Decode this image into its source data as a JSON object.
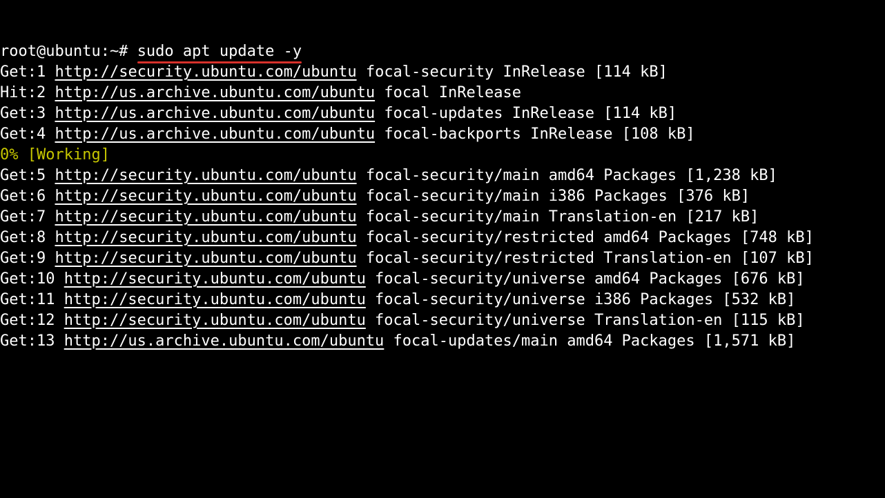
{
  "prompt": "root@ubuntu:~# ",
  "command": "sudo apt update -y",
  "status_line": "0% [Working]",
  "lines": [
    {
      "type": "get",
      "prefix": "Get:1 ",
      "url": "http://security.ubuntu.com/ubuntu",
      "suffix": " focal-security InRelease [114 kB]"
    },
    {
      "type": "hit",
      "prefix": "Hit:2 ",
      "url": "http://us.archive.ubuntu.com/ubuntu",
      "suffix": " focal InRelease"
    },
    {
      "type": "get",
      "prefix": "Get:3 ",
      "url": "http://us.archive.ubuntu.com/ubuntu",
      "suffix": " focal-updates InRelease [114 kB]"
    },
    {
      "type": "get",
      "prefix": "Get:4 ",
      "url": "http://us.archive.ubuntu.com/ubuntu",
      "suffix": " focal-backports InRelease [108 kB]"
    },
    {
      "type": "status"
    },
    {
      "type": "get",
      "prefix": "Get:5 ",
      "url": "http://security.ubuntu.com/ubuntu",
      "suffix": " focal-security/main amd64 Packages [1,238 kB]"
    },
    {
      "type": "get",
      "prefix": "Get:6 ",
      "url": "http://security.ubuntu.com/ubuntu",
      "suffix": " focal-security/main i386 Packages [376 kB]"
    },
    {
      "type": "get",
      "prefix": "Get:7 ",
      "url": "http://security.ubuntu.com/ubuntu",
      "suffix": " focal-security/main Translation-en [217 kB]"
    },
    {
      "type": "get",
      "prefix": "Get:8 ",
      "url": "http://security.ubuntu.com/ubuntu",
      "suffix": " focal-security/restricted amd64 Packages [748 kB]"
    },
    {
      "type": "get",
      "prefix": "Get:9 ",
      "url": "http://security.ubuntu.com/ubuntu",
      "suffix": " focal-security/restricted Translation-en [107 kB]"
    },
    {
      "type": "get",
      "prefix": "Get:10 ",
      "url": "http://security.ubuntu.com/ubuntu",
      "suffix": " focal-security/universe amd64 Packages [676 kB]"
    },
    {
      "type": "get",
      "prefix": "Get:11 ",
      "url": "http://security.ubuntu.com/ubuntu",
      "suffix": " focal-security/universe i386 Packages [532 kB]"
    },
    {
      "type": "get",
      "prefix": "Get:12 ",
      "url": "http://security.ubuntu.com/ubuntu",
      "suffix": " focal-security/universe Translation-en [115 kB]"
    },
    {
      "type": "get",
      "prefix": "Get:13 ",
      "url": "http://us.archive.ubuntu.com/ubuntu",
      "suffix": " focal-updates/main amd64 Packages [1,571 kB]"
    }
  ]
}
